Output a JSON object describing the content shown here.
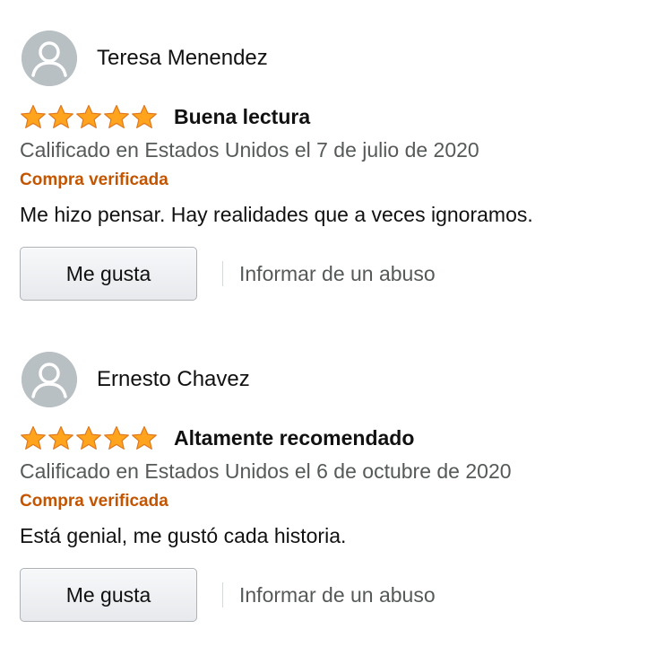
{
  "colors": {
    "star_fill": "#ffa41c",
    "star_stroke": "#de7921",
    "verified": "#c45500",
    "muted_text": "#565959",
    "avatar_bg": "#b8c0c3"
  },
  "reviews": [
    {
      "reviewer": "Teresa Menendez",
      "avatar_icon": "default-user-icon",
      "rating": 5,
      "rating_max": 5,
      "title": "Buena lectura",
      "date_line": "Calificado en Estados Unidos el 7 de julio de 2020",
      "verified_label": "Compra verificada",
      "body": "Me hizo pensar. Hay realidades que a veces ignoramos.",
      "helpful_label": "Me gusta",
      "report_label": "Informar de un abuso"
    },
    {
      "reviewer": "Ernesto Chavez",
      "avatar_icon": "default-user-icon",
      "rating": 5,
      "rating_max": 5,
      "title": "Altamente recomendado",
      "date_line": "Calificado en Estados Unidos el 6 de octubre de 2020",
      "verified_label": "Compra verificada",
      "body": "Está genial, me gustó cada historia.",
      "helpful_label": "Me gusta",
      "report_label": "Informar de un abuso"
    }
  ]
}
